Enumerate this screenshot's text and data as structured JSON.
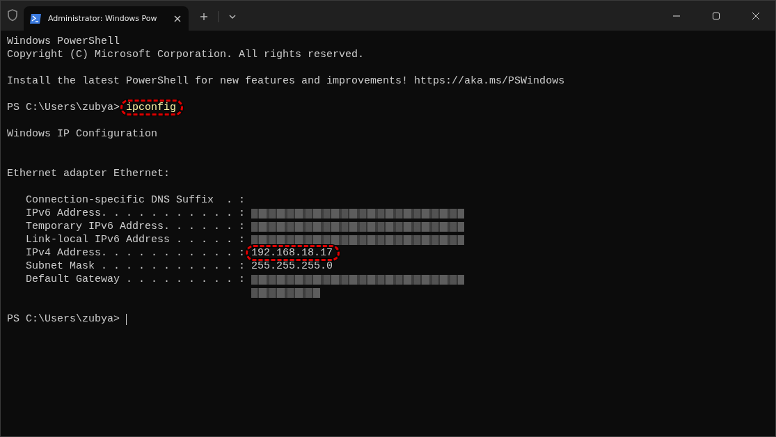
{
  "window": {
    "tab": {
      "title": "Administrator: Windows Pow",
      "selected": true
    }
  },
  "terminal": {
    "lines": [
      {
        "kind": "text",
        "text": "Windows PowerShell"
      },
      {
        "kind": "text",
        "text": "Copyright (C) Microsoft Corporation. All rights reserved."
      },
      {
        "kind": "blank"
      },
      {
        "kind": "text",
        "text": "Install the latest PowerShell for new features and improvements! https://aka.ms/PSWindows"
      },
      {
        "kind": "blank"
      },
      {
        "kind": "prompt",
        "prompt": "PS C:\\Users\\zubya>",
        "command": "ipconfig",
        "highlighted": true
      },
      {
        "kind": "blank"
      },
      {
        "kind": "text",
        "text": "Windows IP Configuration"
      },
      {
        "kind": "blank"
      },
      {
        "kind": "blank"
      },
      {
        "kind": "text",
        "text": "Ethernet adapter Ethernet:"
      },
      {
        "kind": "blank"
      },
      {
        "kind": "field",
        "label": "Connection-specific DNS Suffix  . :"
      },
      {
        "kind": "field",
        "label": "IPv6 Address. . . . . . . . . . . :",
        "redacted": true
      },
      {
        "kind": "field",
        "label": "Temporary IPv6 Address. . . . . . :",
        "redacted": true
      },
      {
        "kind": "field",
        "label": "Link-local IPv6 Address . . . . . :",
        "redacted": true
      },
      {
        "kind": "field",
        "label": "IPv4 Address. . . . . . . . . . . :",
        "value": "192.168.18.17",
        "highlighted": true
      },
      {
        "kind": "field",
        "label": "Subnet Mask . . . . . . . . . . . :",
        "value": "255.255.255.0"
      },
      {
        "kind": "field",
        "label": "Default Gateway . . . . . . . . . :",
        "redacted": true
      },
      {
        "kind": "continuation",
        "redacted": true
      },
      {
        "kind": "blank"
      },
      {
        "kind": "prompt",
        "prompt": "PS C:\\Users\\zubya>",
        "cursor": true
      }
    ]
  }
}
